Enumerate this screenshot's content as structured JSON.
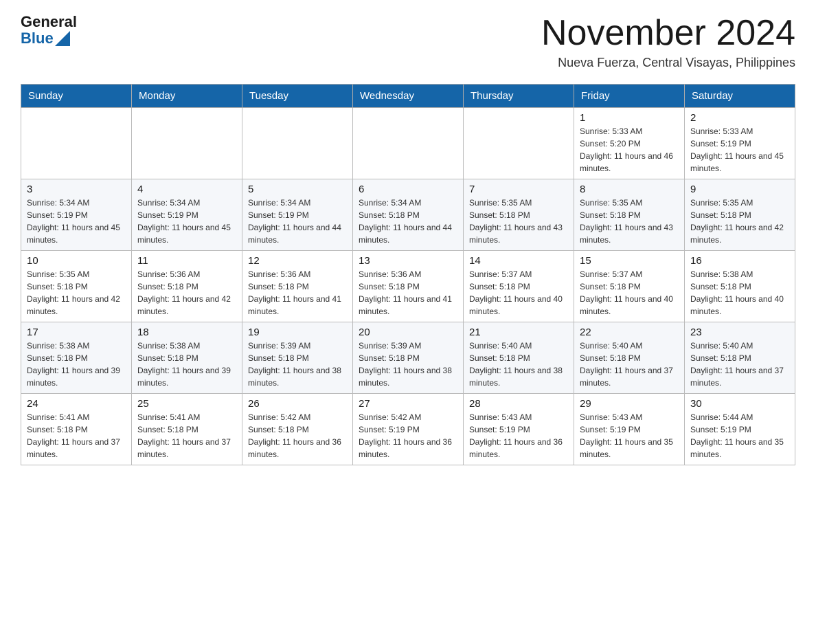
{
  "header": {
    "logo": {
      "general_text": "General",
      "blue_text": "Blue"
    },
    "title": "November 2024",
    "subtitle": "Nueva Fuerza, Central Visayas, Philippines"
  },
  "weekdays": [
    "Sunday",
    "Monday",
    "Tuesday",
    "Wednesday",
    "Thursday",
    "Friday",
    "Saturday"
  ],
  "weeks": [
    [
      {
        "day": "",
        "info": ""
      },
      {
        "day": "",
        "info": ""
      },
      {
        "day": "",
        "info": ""
      },
      {
        "day": "",
        "info": ""
      },
      {
        "day": "",
        "info": ""
      },
      {
        "day": "1",
        "info": "Sunrise: 5:33 AM\nSunset: 5:20 PM\nDaylight: 11 hours and 46 minutes."
      },
      {
        "day": "2",
        "info": "Sunrise: 5:33 AM\nSunset: 5:19 PM\nDaylight: 11 hours and 45 minutes."
      }
    ],
    [
      {
        "day": "3",
        "info": "Sunrise: 5:34 AM\nSunset: 5:19 PM\nDaylight: 11 hours and 45 minutes."
      },
      {
        "day": "4",
        "info": "Sunrise: 5:34 AM\nSunset: 5:19 PM\nDaylight: 11 hours and 45 minutes."
      },
      {
        "day": "5",
        "info": "Sunrise: 5:34 AM\nSunset: 5:19 PM\nDaylight: 11 hours and 44 minutes."
      },
      {
        "day": "6",
        "info": "Sunrise: 5:34 AM\nSunset: 5:18 PM\nDaylight: 11 hours and 44 minutes."
      },
      {
        "day": "7",
        "info": "Sunrise: 5:35 AM\nSunset: 5:18 PM\nDaylight: 11 hours and 43 minutes."
      },
      {
        "day": "8",
        "info": "Sunrise: 5:35 AM\nSunset: 5:18 PM\nDaylight: 11 hours and 43 minutes."
      },
      {
        "day": "9",
        "info": "Sunrise: 5:35 AM\nSunset: 5:18 PM\nDaylight: 11 hours and 42 minutes."
      }
    ],
    [
      {
        "day": "10",
        "info": "Sunrise: 5:35 AM\nSunset: 5:18 PM\nDaylight: 11 hours and 42 minutes."
      },
      {
        "day": "11",
        "info": "Sunrise: 5:36 AM\nSunset: 5:18 PM\nDaylight: 11 hours and 42 minutes."
      },
      {
        "day": "12",
        "info": "Sunrise: 5:36 AM\nSunset: 5:18 PM\nDaylight: 11 hours and 41 minutes."
      },
      {
        "day": "13",
        "info": "Sunrise: 5:36 AM\nSunset: 5:18 PM\nDaylight: 11 hours and 41 minutes."
      },
      {
        "day": "14",
        "info": "Sunrise: 5:37 AM\nSunset: 5:18 PM\nDaylight: 11 hours and 40 minutes."
      },
      {
        "day": "15",
        "info": "Sunrise: 5:37 AM\nSunset: 5:18 PM\nDaylight: 11 hours and 40 minutes."
      },
      {
        "day": "16",
        "info": "Sunrise: 5:38 AM\nSunset: 5:18 PM\nDaylight: 11 hours and 40 minutes."
      }
    ],
    [
      {
        "day": "17",
        "info": "Sunrise: 5:38 AM\nSunset: 5:18 PM\nDaylight: 11 hours and 39 minutes."
      },
      {
        "day": "18",
        "info": "Sunrise: 5:38 AM\nSunset: 5:18 PM\nDaylight: 11 hours and 39 minutes."
      },
      {
        "day": "19",
        "info": "Sunrise: 5:39 AM\nSunset: 5:18 PM\nDaylight: 11 hours and 38 minutes."
      },
      {
        "day": "20",
        "info": "Sunrise: 5:39 AM\nSunset: 5:18 PM\nDaylight: 11 hours and 38 minutes."
      },
      {
        "day": "21",
        "info": "Sunrise: 5:40 AM\nSunset: 5:18 PM\nDaylight: 11 hours and 38 minutes."
      },
      {
        "day": "22",
        "info": "Sunrise: 5:40 AM\nSunset: 5:18 PM\nDaylight: 11 hours and 37 minutes."
      },
      {
        "day": "23",
        "info": "Sunrise: 5:40 AM\nSunset: 5:18 PM\nDaylight: 11 hours and 37 minutes."
      }
    ],
    [
      {
        "day": "24",
        "info": "Sunrise: 5:41 AM\nSunset: 5:18 PM\nDaylight: 11 hours and 37 minutes."
      },
      {
        "day": "25",
        "info": "Sunrise: 5:41 AM\nSunset: 5:18 PM\nDaylight: 11 hours and 37 minutes."
      },
      {
        "day": "26",
        "info": "Sunrise: 5:42 AM\nSunset: 5:18 PM\nDaylight: 11 hours and 36 minutes."
      },
      {
        "day": "27",
        "info": "Sunrise: 5:42 AM\nSunset: 5:19 PM\nDaylight: 11 hours and 36 minutes."
      },
      {
        "day": "28",
        "info": "Sunrise: 5:43 AM\nSunset: 5:19 PM\nDaylight: 11 hours and 36 minutes."
      },
      {
        "day": "29",
        "info": "Sunrise: 5:43 AM\nSunset: 5:19 PM\nDaylight: 11 hours and 35 minutes."
      },
      {
        "day": "30",
        "info": "Sunrise: 5:44 AM\nSunset: 5:19 PM\nDaylight: 11 hours and 35 minutes."
      }
    ]
  ]
}
